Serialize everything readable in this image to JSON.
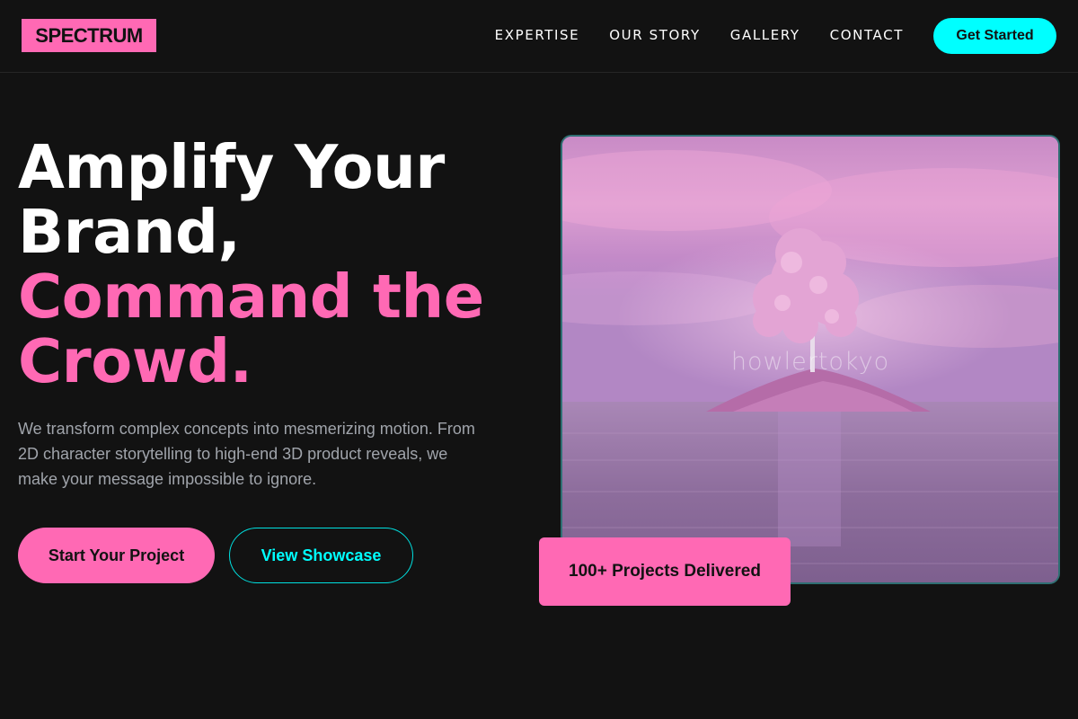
{
  "header": {
    "logo": "SPECTRUM",
    "nav": [
      "EXPERTISE",
      "OUR STORY",
      "GALLERY",
      "CONTACT"
    ],
    "cta": "Get Started"
  },
  "hero": {
    "headline_white_1": "Amplify Your",
    "headline_white_2": "Brand,",
    "headline_pink_1": "Command the",
    "headline_pink_2": "Crowd.",
    "subtitle": "We transform complex concepts into mesmerizing motion. From 2D character storytelling to high-end 3D product reveals, we make your message impossible to ignore.",
    "primary_button": "Start Your Project",
    "secondary_button": "View Showcase"
  },
  "showcase": {
    "watermark": "howlertokyo",
    "badge": "100+ Projects Delivered"
  },
  "colors": {
    "background": "#121212",
    "accent_pink": "#ff69b4",
    "accent_cyan": "#00ffff",
    "text_muted": "#a0a4ab"
  },
  "icons": {
    "image": "pink-tree-island-illustration"
  }
}
